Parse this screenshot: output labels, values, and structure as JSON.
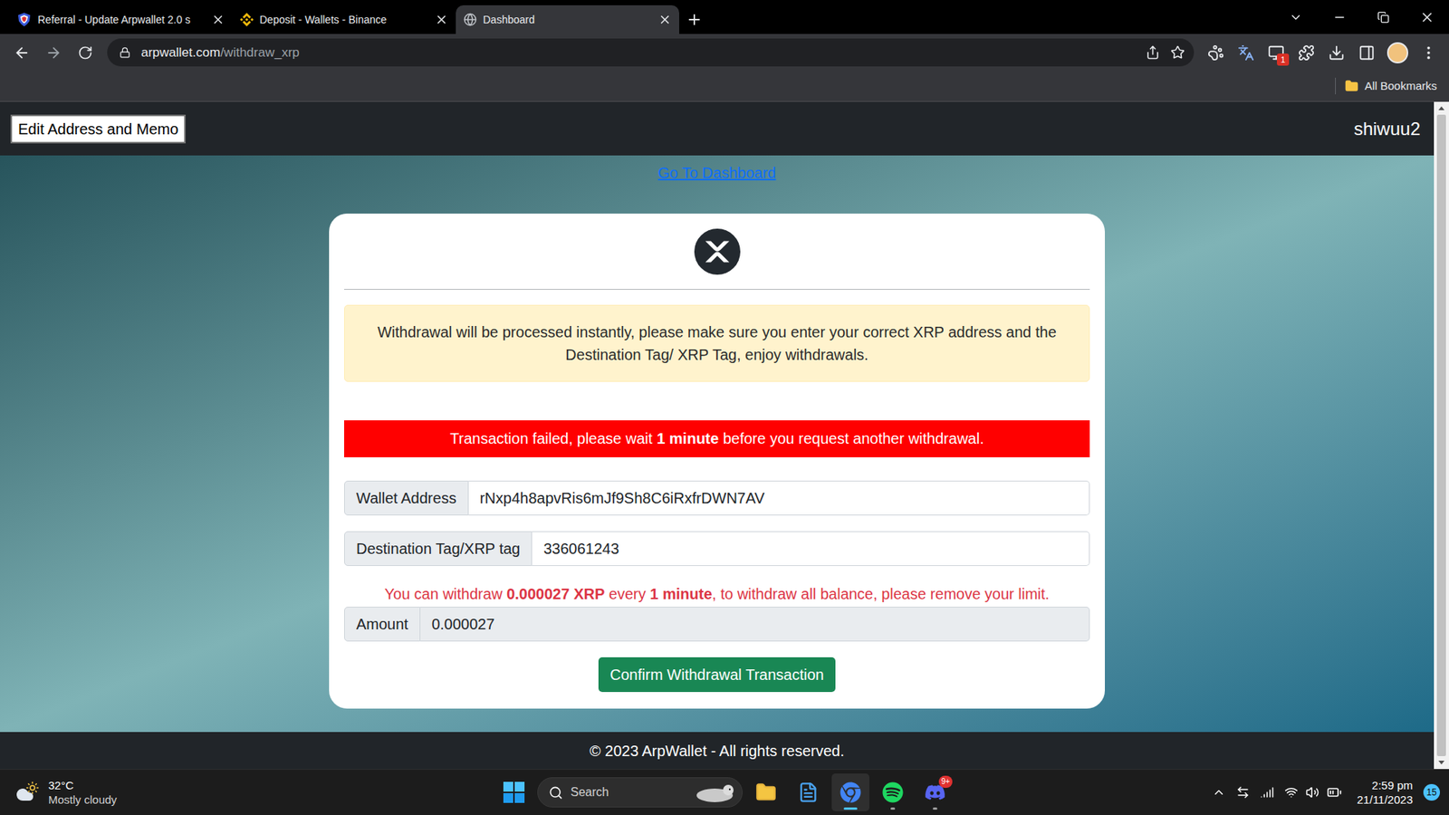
{
  "browser": {
    "tabs": [
      {
        "label": "Referral - Update Arpwallet 2.0 s",
        "selected": false
      },
      {
        "label": "Deposit - Wallets - Binance",
        "selected": false
      },
      {
        "label": "Dashboard",
        "selected": true
      }
    ],
    "address": {
      "host": "arpwallet.com",
      "path": "/withdraw_xrp"
    },
    "extension_badge": "1",
    "bookmarks": [
      "All Bookmarks"
    ]
  },
  "page": {
    "navbar": {
      "button": "Edit Address and Memo",
      "username": "shiwuu2"
    },
    "link": "Go To Dashboard",
    "notice": "Withdrawal will be processed instantly, please make sure you enter your correct XRP address and the Destination Tag/ XRP Tag, enjoy withdrawals.",
    "error": [
      {
        "text": "Transaction failed, please wait ",
        "bold": false
      },
      {
        "text": "1 minute",
        "bold": true
      },
      {
        "text": " before you request another withdrawal.",
        "bold": false
      }
    ],
    "fields": [
      {
        "label": "Wallet Address",
        "value": "rNxp4h8apvRis6mJf9Sh8C6iRxfrDWN7AV",
        "readonly": false
      },
      {
        "label": "Destination Tag/XRP tag",
        "value": "336061243",
        "readonly": false
      }
    ],
    "limit": [
      {
        "text": "You can withdraw ",
        "bold": false
      },
      {
        "text": "0.000027 XRP",
        "bold": true
      },
      {
        "text": " every ",
        "bold": false
      },
      {
        "text": "1 minute",
        "bold": true
      },
      {
        "text": ", to withdraw all balance, please remove your limit.",
        "bold": false
      }
    ],
    "amount": {
      "label": "Amount",
      "value": "0.000027",
      "readonly": true
    },
    "button": "Confirm Withdrawal Transaction",
    "footer": "© 2023 ArpWallet - All rights reserved."
  },
  "taskbar": {
    "weather": {
      "temperature": "32°C",
      "condition": "Mostly cloudy"
    },
    "search": {
      "placeholder": "Search"
    },
    "discord_badge": "9+",
    "time": "2:59 pm",
    "date": "21/11/2023",
    "notifications": "15"
  }
}
